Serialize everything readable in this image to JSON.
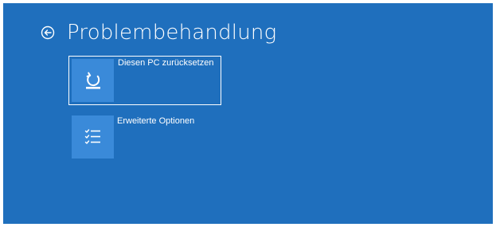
{
  "header": {
    "title": "Problembehandlung",
    "back_icon": "back-arrow-circle-icon"
  },
  "options": [
    {
      "label": "Diesen PC zurücksetzen",
      "icon": "reset-pc-icon",
      "selected": true
    },
    {
      "label": "Erweiterte Optionen",
      "icon": "checklist-icon",
      "selected": false
    }
  ],
  "colors": {
    "background": "#1f6fbd",
    "tile_icon_bg": "#3a8ad9",
    "text": "#ffffff"
  }
}
